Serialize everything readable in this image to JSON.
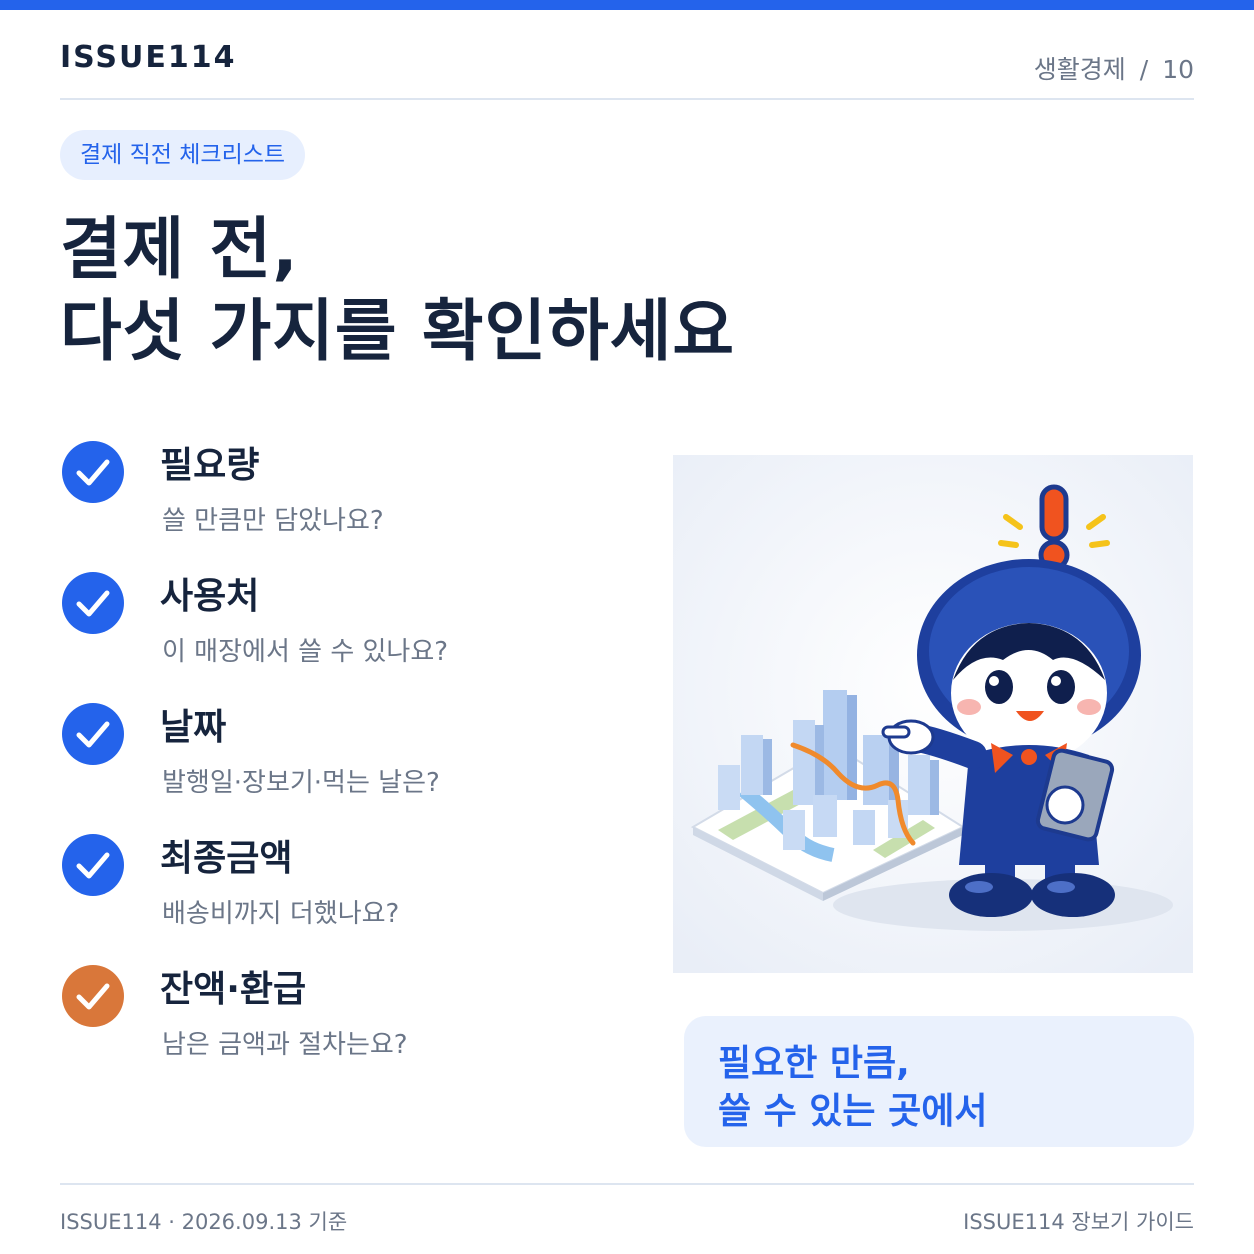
{
  "header": {
    "brand": "ISSUE114",
    "category": "생활경제",
    "separator": "/",
    "page_number": "10"
  },
  "tag": "결제 직전 체크리스트",
  "headline": {
    "line1": "결제 전,",
    "line2": "다섯 가지를 확인하세요"
  },
  "checklist": [
    {
      "title": "필요량",
      "subtitle": "쓸 만큼만 담았나요?",
      "icon": "check-icon"
    },
    {
      "title": "사용처",
      "subtitle": "이 매장에서 쓸 수 있나요?",
      "icon": "check-icon"
    },
    {
      "title": "날짜",
      "subtitle": "발행일·장보기·먹는 날은?",
      "icon": "check-icon"
    },
    {
      "title": "최종금액",
      "subtitle": "배송비까지 더했나요?",
      "icon": "check-icon"
    },
    {
      "title": "잔액·환급",
      "subtitle": "남은 금액과 절차는요?",
      "icon": "check-icon"
    }
  ],
  "callout": {
    "line1": "필요한 만큼,",
    "line2": "쓸 수 있는 곳에서"
  },
  "footer": {
    "left": "ISSUE114 · 2026.09.13 기준",
    "right": "ISSUE114 장보기 가이드"
  },
  "colors": {
    "accent": "#2463eb",
    "accent_light": "#e7effe",
    "highlight": "#d9773a",
    "heading": "#16243d",
    "muted": "#6b7688"
  }
}
